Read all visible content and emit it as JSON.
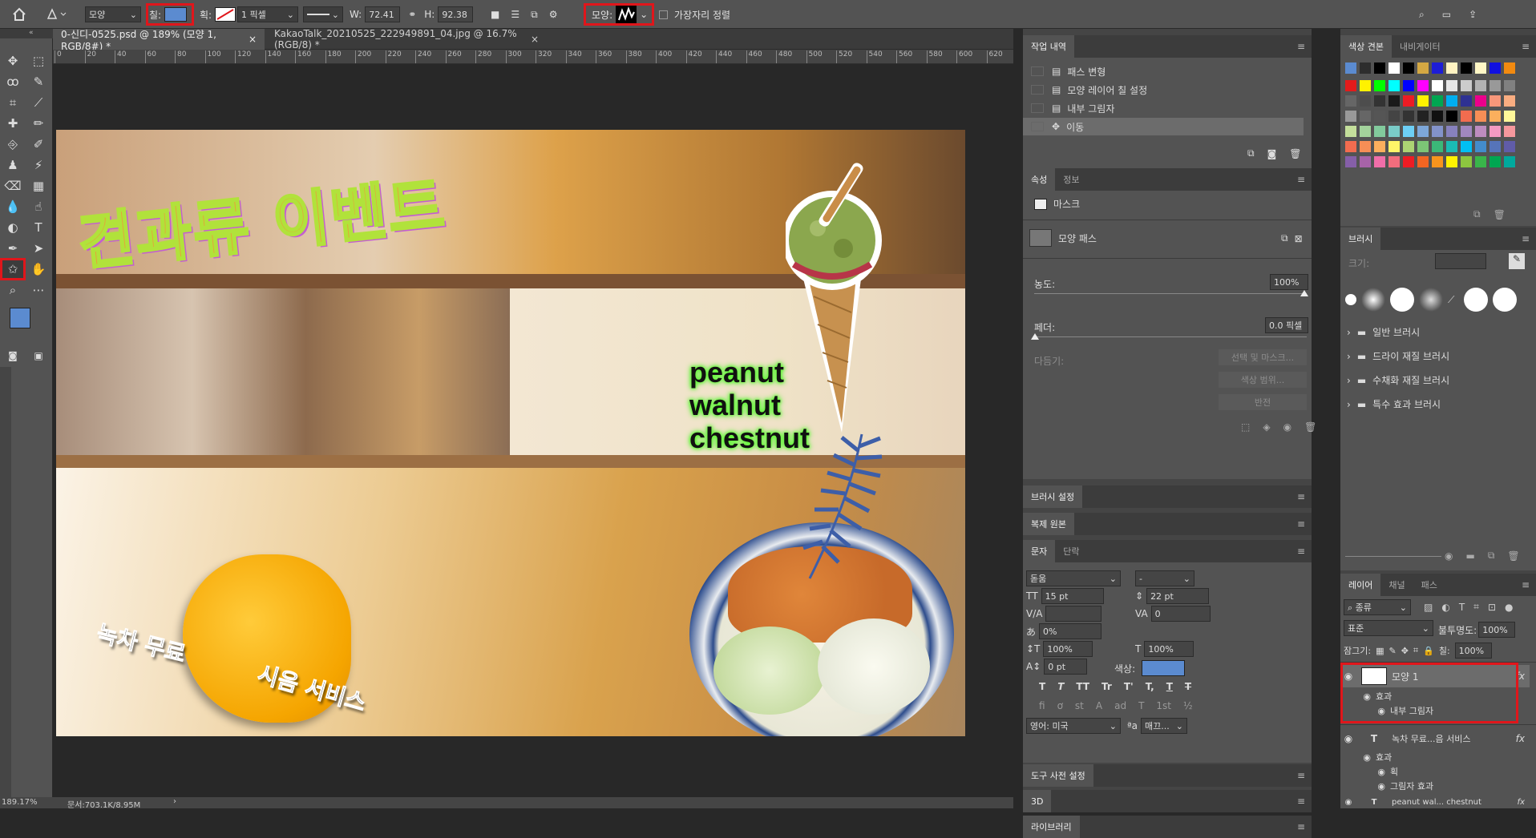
{
  "options_bar": {
    "mode": "모양",
    "fill_label": "칠:",
    "fill_color": "#5b8bd0",
    "stroke_label": "획:",
    "stroke_width": "1 픽셀",
    "w_label": "W:",
    "w_value": "72.41",
    "h_label": "H:",
    "h_value": "92.38",
    "shape_label": "모양:",
    "align_edges": "가장자리 정렬"
  },
  "tabs": [
    {
      "label": "0-신디-0525.psd @ 189% (모양 1, RGB/8#) *"
    },
    {
      "label": "KakaoTalk_20210525_222949891_04.jpg @ 16.7% (RGB/8) *"
    }
  ],
  "ruler_ticks": [
    "0",
    "20",
    "40",
    "60",
    "80",
    "100",
    "120",
    "140",
    "160",
    "180",
    "200",
    "220",
    "240",
    "260",
    "280",
    "300",
    "320",
    "340",
    "360",
    "380",
    "400",
    "420",
    "440",
    "460",
    "480",
    "500",
    "520",
    "540",
    "560",
    "580",
    "600",
    "620"
  ],
  "status": {
    "zoom": "189.17%",
    "doc": "문서:703.1K/8.95M"
  },
  "canvas": {
    "headline": "견과류 이벤트",
    "nuts": [
      "peanut",
      "walnut",
      "chestnut"
    ],
    "tea": "녹차 무료",
    "service": "시음 서비스"
  },
  "history": {
    "tab": "작업 내역",
    "items": [
      "패스 변형",
      "모양 레이어 칠 설정",
      "내부 그림자",
      "이동"
    ]
  },
  "properties": {
    "tabs": [
      "속성",
      "정보"
    ],
    "mask": "마스크",
    "shape_path": "모양 패스",
    "density_label": "농도:",
    "density": "100%",
    "feather_label": "페더:",
    "feather": "0.0 픽셀",
    "refine_label": "다듬기:",
    "buttons": [
      "선택 및 마스크...",
      "색상 범위...",
      "반전"
    ]
  },
  "collapsed": [
    "브러시 설정",
    "복제 원본"
  ],
  "character": {
    "tabs": [
      "문자",
      "단락"
    ],
    "font": "돋움",
    "style": "-",
    "size": "15 pt",
    "leading": "22 pt",
    "tracking": "0",
    "scale_pct": "0%",
    "vscale": "100%",
    "hscale": "100%",
    "baseline": "0 pt",
    "color_label": "색상:",
    "color": "#5b8bd0",
    "language": "영어: 미국",
    "aa": "매끄...",
    "styles": [
      "T",
      "T",
      "TT",
      "Tr",
      "T'",
      "T,",
      "T",
      "T"
    ],
    "opentype": [
      "fi",
      "ơ",
      "st",
      "A",
      "ad",
      "T",
      "1st",
      "½"
    ]
  },
  "bottom_panels": [
    "도구 사전 설정",
    "3D",
    "라이브러리"
  ],
  "swatches": {
    "tabs": [
      "색상 견본",
      "내비게이터"
    ],
    "row0": [
      "#5b8bd0",
      "#2d2d2d",
      "#000000",
      "#ffffff",
      "#000000",
      "#d4a843",
      "#1d1dd6",
      "#fff3c2",
      "#000000",
      "#fff7c6",
      "#1010e0",
      "#f28a10"
    ],
    "rows": [
      [
        "#e31b1b",
        "#fff200",
        "#00ff00",
        "#00ffff",
        "#0000ff",
        "#ff00ff",
        "#ffffff",
        "#e6e6e6",
        "#cccccc",
        "#b3b3b3",
        "#999999",
        "#808080"
      ],
      [
        "#666666",
        "#4d4d4d",
        "#333333",
        "#1a1a1a",
        "#ed1c24",
        "#fff200",
        "#00a651",
        "#00aeef",
        "#2e3192",
        "#ec008c",
        "#f7977a",
        "#f9ad81"
      ],
      [
        "#999999",
        "#666666",
        "#555555",
        "#444444",
        "#333333",
        "#222222",
        "#111111",
        "#000000",
        "#f26c4f",
        "#f68e56",
        "#fbaf5d",
        "#fff799"
      ],
      [
        "#c4df9b",
        "#a3d39c",
        "#82ca9c",
        "#7accc8",
        "#6dcff6",
        "#7da7d9",
        "#8393ca",
        "#8781bd",
        "#a187be",
        "#bd8cbf",
        "#f49ac2",
        "#f6989d"
      ],
      [
        "#f26c4f",
        "#f68e56",
        "#fbaf5d",
        "#fff568",
        "#acd373",
        "#7cc576",
        "#3bb878",
        "#1abbb4",
        "#00bff3",
        "#438ccb",
        "#5674b9",
        "#605ca8"
      ],
      [
        "#855fa8",
        "#a763a8",
        "#f06ea9",
        "#f26d7d",
        "#ed1c24",
        "#f26522",
        "#f7941d",
        "#fff200",
        "#8dc63f",
        "#39b54a",
        "#00a651",
        "#00a99d"
      ]
    ]
  },
  "brushes": {
    "title": "브러시",
    "size_label": "크기:",
    "groups": [
      "일반 브러시",
      "드라이 재질 브러시",
      "수채화 재질 브러시",
      "특수 효과 브러시"
    ]
  },
  "layers": {
    "tabs": [
      "레이어",
      "채널",
      "패스"
    ],
    "filter": "종류",
    "blend": "표준",
    "opacity_label": "불투명도:",
    "opacity": "100%",
    "lock_label": "잠그기:",
    "fill_label": "칠:",
    "fill": "100%",
    "items": [
      {
        "name": "모양 1",
        "type": "shape",
        "fx": "fx"
      },
      {
        "name": "효과",
        "type": "effect"
      },
      {
        "name": "내부 그림자",
        "type": "effect-item"
      },
      {
        "name": "녹차 무료...음 서비스",
        "type": "text",
        "fx": "fx"
      },
      {
        "name": "효과",
        "type": "effect"
      },
      {
        "name": "획",
        "type": "effect-item"
      },
      {
        "name": "그림자 효과",
        "type": "effect-item"
      },
      {
        "name": "peanut wal... chestnut",
        "type": "text",
        "fx": "fx"
      }
    ]
  }
}
